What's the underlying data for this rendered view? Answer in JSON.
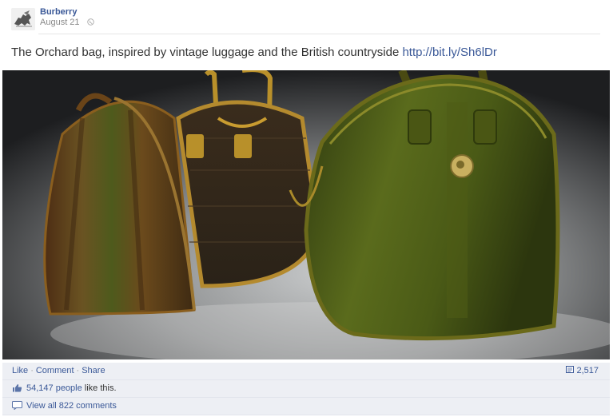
{
  "post": {
    "page_name": "Burberry",
    "date": "August 21",
    "message_text": "The Orchard bag, inspired by vintage luggage and the British countryside",
    "link_text": "http://bit.ly/Sh6lDr"
  },
  "actions": {
    "like": "Like",
    "comment": "Comment",
    "share": "Share",
    "share_count": "2,517"
  },
  "likes": {
    "count": "54,147 people",
    "suffix": "like this."
  },
  "comments": {
    "view_all": "View all 822 comments"
  },
  "colors": {
    "link": "#3b5998",
    "ufi_background": "#edeff4"
  }
}
